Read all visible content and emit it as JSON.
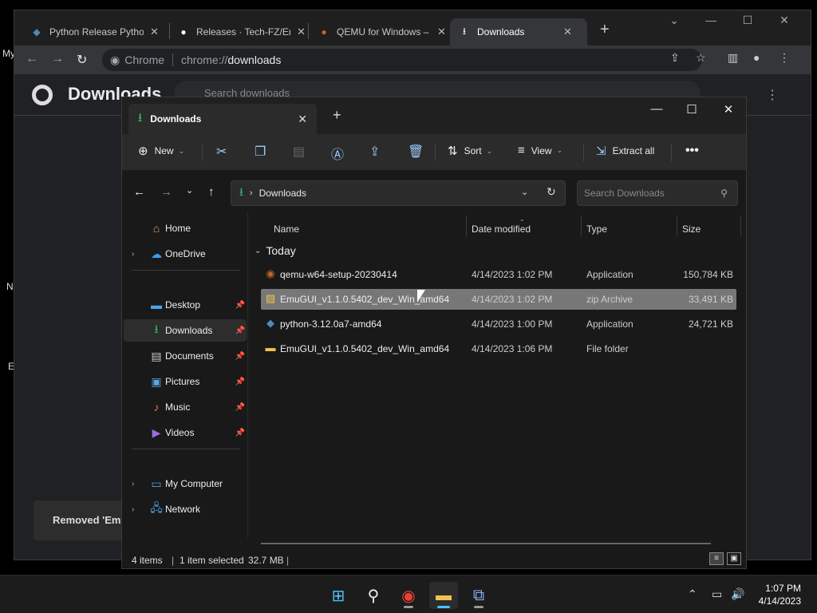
{
  "desktop": {
    "frag_my": "My",
    "frag_n": "N",
    "frag_e": "E"
  },
  "chrome": {
    "tabs": [
      {
        "title": "Python Release Pytho",
        "icon": "python-icon"
      },
      {
        "title": "Releases · Tech-FZ/Em",
        "icon": "github-icon"
      },
      {
        "title": "QEMU for Windows –",
        "icon": "qemu-icon"
      },
      {
        "title": "Downloads",
        "icon": "download-icon"
      }
    ],
    "omnibox": {
      "site": "Chrome",
      "scheme": "chrome://",
      "path": "downloads"
    },
    "page": {
      "title": "Downloads",
      "search_placeholder": "Search downloads",
      "toast": "Removed 'Emu"
    }
  },
  "explorer": {
    "tab_title": "Downloads",
    "commands": {
      "new": "New",
      "sort": "Sort",
      "view": "View",
      "extract_all": "Extract all"
    },
    "address": {
      "crumb": "Downloads",
      "search_placeholder": "Search Downloads"
    },
    "nav": [
      {
        "label": "Home"
      },
      {
        "label": "OneDrive"
      },
      {
        "label": "Desktop"
      },
      {
        "label": "Downloads"
      },
      {
        "label": "Documents"
      },
      {
        "label": "Pictures"
      },
      {
        "label": "Music"
      },
      {
        "label": "Videos"
      },
      {
        "label": "My Computer"
      },
      {
        "label": "Network"
      }
    ],
    "columns": {
      "name": "Name",
      "date": "Date modified",
      "type": "Type",
      "size": "Size"
    },
    "group": "Today",
    "files": [
      {
        "name": "qemu-w64-setup-20230414",
        "date": "4/14/2023 1:02 PM",
        "type": "Application",
        "size": "150,784 KB",
        "icon": "qemu-installer-icon"
      },
      {
        "name": "EmuGUI_v1.1.0.5402_dev_Win_amd64",
        "date": "4/14/2023 1:02 PM",
        "type": "zip Archive",
        "size": "33,491 KB",
        "icon": "zip-icon"
      },
      {
        "name": "python-3.12.0a7-amd64",
        "date": "4/14/2023 1:00 PM",
        "type": "Application",
        "size": "24,721 KB",
        "icon": "python-installer-icon"
      },
      {
        "name": "EmuGUI_v1.1.0.5402_dev_Win_amd64",
        "date": "4/14/2023 1:06 PM",
        "type": "File folder",
        "size": "",
        "icon": "folder-icon"
      }
    ],
    "status": {
      "items": "4 items",
      "selected": "1 item selected",
      "size": "32.7 MB"
    }
  },
  "taskbar": {
    "time": "1:07 PM",
    "date": "4/14/2023"
  },
  "colors": {
    "accent": "#4cc2ff",
    "download_green": "#3bbd6c",
    "selection": "#777777",
    "folder_yellow": "#f2c14e"
  }
}
